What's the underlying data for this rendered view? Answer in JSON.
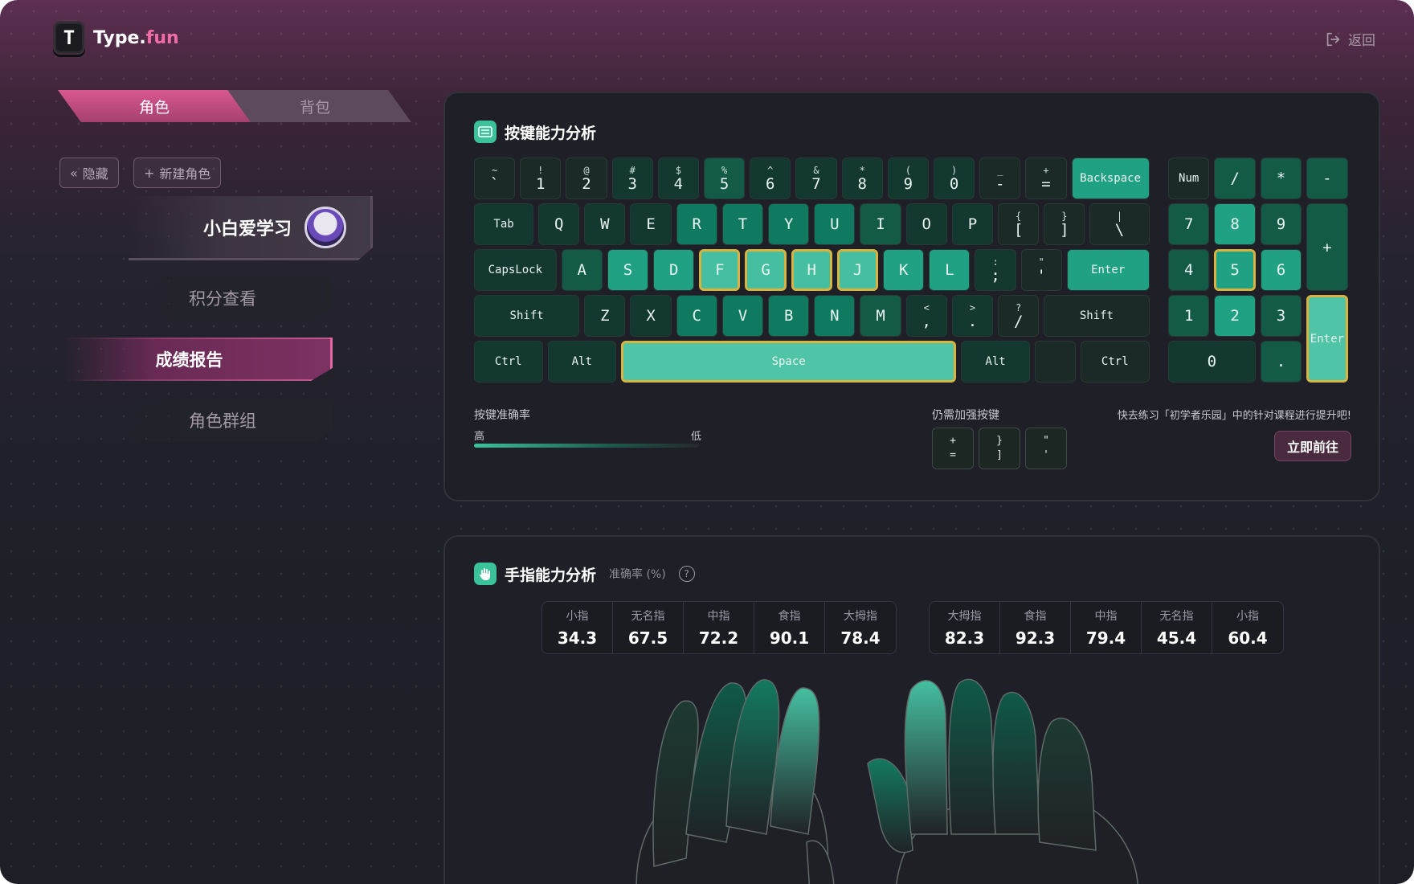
{
  "app": {
    "logo_letter": "T",
    "logo_name": "Type.",
    "logo_suffix": "fun",
    "back_label": "返回"
  },
  "tabs": [
    {
      "label": "角色",
      "active": true
    },
    {
      "label": "背包",
      "active": false
    }
  ],
  "actions": {
    "hide_label": "隐藏",
    "new_role_label": "新建角色"
  },
  "character": {
    "name": "小白爱学习"
  },
  "menu": [
    {
      "label": "积分查看",
      "active": false
    },
    {
      "label": "成绩报告",
      "active": true
    },
    {
      "label": "角色群组",
      "active": false
    }
  ],
  "keys_panel": {
    "title": "按键能力分析",
    "accuracy_label": "按键准确率",
    "high_label": "高",
    "low_label": "低",
    "weak_label": "仍需加强按键",
    "weak_keys": [
      {
        "top": "+",
        "bottom": "="
      },
      {
        "top": "}",
        "bottom": "]"
      },
      {
        "top": "\"",
        "bottom": "'"
      }
    ],
    "tip": "快去练习「初学者乐园」中的针对课程进行提升吧!",
    "go_label": "立即前往"
  },
  "fingers_panel": {
    "title": "手指能力分析",
    "subtitle": "准确率 (%)",
    "help": "?",
    "left": [
      {
        "label": "小指",
        "value": "34.3"
      },
      {
        "label": "无名指",
        "value": "67.5"
      },
      {
        "label": "中指",
        "value": "72.2"
      },
      {
        "label": "食指",
        "value": "90.1"
      },
      {
        "label": "大拇指",
        "value": "78.4"
      }
    ],
    "right": [
      {
        "label": "大拇指",
        "value": "82.3"
      },
      {
        "label": "食指",
        "value": "92.3"
      },
      {
        "label": "中指",
        "value": "79.4"
      },
      {
        "label": "无名指",
        "value": "45.4"
      },
      {
        "label": "小指",
        "value": "60.4"
      }
    ]
  },
  "colors": {
    "accent_pink": "#d8578f",
    "accent_green": "#3cc29b",
    "highlight": "#d9b340"
  },
  "keyboard": {
    "main": [
      [
        {
          "s": "~",
          "m": "`",
          "lvl": 0
        },
        {
          "s": "!",
          "m": "1",
          "lvl": 0
        },
        {
          "s": "@",
          "m": "2",
          "lvl": 0
        },
        {
          "s": "#",
          "m": "3",
          "lvl": 1
        },
        {
          "s": "$",
          "m": "4",
          "lvl": 1
        },
        {
          "s": "%",
          "m": "5",
          "lvl": 2
        },
        {
          "s": "^",
          "m": "6",
          "lvl": 1
        },
        {
          "s": "&",
          "m": "7",
          "lvl": 1
        },
        {
          "s": "*",
          "m": "8",
          "lvl": 1
        },
        {
          "s": "(",
          "m": "9",
          "lvl": 1
        },
        {
          "s": ")",
          "m": "0",
          "lvl": 1
        },
        {
          "s": "_",
          "m": "-",
          "lvl": 0
        },
        {
          "s": "+",
          "m": "=",
          "lvl": 0
        },
        {
          "m": "Backspace",
          "word": true,
          "lvl": 4,
          "w": 1.8
        }
      ],
      [
        {
          "m": "Tab",
          "word": true,
          "lvl": 1,
          "w": 1.4
        },
        {
          "m": "Q",
          "lvl": 1
        },
        {
          "m": "W",
          "lvl": 1
        },
        {
          "m": "E",
          "lvl": 1
        },
        {
          "m": "R",
          "lvl": 3
        },
        {
          "m": "T",
          "lvl": 3
        },
        {
          "m": "Y",
          "lvl": 3
        },
        {
          "m": "U",
          "lvl": 3
        },
        {
          "m": "I",
          "lvl": 2
        },
        {
          "m": "O",
          "lvl": 1
        },
        {
          "m": "P",
          "lvl": 1
        },
        {
          "s": "{",
          "m": "[",
          "lvl": 0
        },
        {
          "s": "}",
          "m": "]",
          "lvl": 0
        },
        {
          "s": "|",
          "m": "\\",
          "lvl": 0,
          "w": 1.4
        }
      ],
      [
        {
          "m": "CapsLock",
          "word": true,
          "lvl": 1,
          "w": 1.9
        },
        {
          "m": "A",
          "lvl": 2
        },
        {
          "m": "S",
          "lvl": 4
        },
        {
          "m": "D",
          "lvl": 4
        },
        {
          "m": "F",
          "lvl": 5,
          "hl": true
        },
        {
          "m": "G",
          "lvl": 5,
          "hl": true
        },
        {
          "m": "H",
          "lvl": 5,
          "hl": true
        },
        {
          "m": "J",
          "lvl": 5,
          "hl": true
        },
        {
          "m": "K",
          "lvl": 4
        },
        {
          "m": "L",
          "lvl": 4
        },
        {
          "s": ":",
          "m": ";",
          "lvl": 1
        },
        {
          "s": "\"",
          "m": "'",
          "lvl": 0
        },
        {
          "m": "Enter",
          "word": true,
          "lvl": 4,
          "w": 1.9
        }
      ],
      [
        {
          "m": "Shift",
          "word": true,
          "lvl": 1,
          "w": 2.4
        },
        {
          "m": "Z",
          "lvl": 1
        },
        {
          "m": "X",
          "lvl": 1
        },
        {
          "m": "C",
          "lvl": 3
        },
        {
          "m": "V",
          "lvl": 3
        },
        {
          "m": "B",
          "lvl": 3
        },
        {
          "m": "N",
          "lvl": 3
        },
        {
          "m": "M",
          "lvl": 2
        },
        {
          "s": "<",
          "m": ",",
          "lvl": 1
        },
        {
          "s": ">",
          "m": ".",
          "lvl": 1
        },
        {
          "s": "?",
          "m": "/",
          "lvl": 0
        },
        {
          "m": "Shift",
          "word": true,
          "lvl": 0,
          "w": 2.4
        }
      ],
      [
        {
          "m": "Ctrl",
          "word": true,
          "lvl": 1,
          "w": 1.6
        },
        {
          "m": "Alt",
          "word": true,
          "lvl": 1,
          "w": 1.6
        },
        {
          "m": "Space",
          "word": true,
          "lvl": 6,
          "hl": true,
          "w": 7.4
        },
        {
          "m": "Alt",
          "word": true,
          "lvl": 1,
          "w": 1.6
        },
        {
          "m": "",
          "lvl": 0,
          "w": 1
        },
        {
          "m": "Ctrl",
          "word": true,
          "lvl": 0,
          "w": 1.6
        }
      ]
    ],
    "numpad": [
      {
        "m": "Num",
        "word": true,
        "lvl": 0,
        "c": 0,
        "r": 0
      },
      {
        "m": "/",
        "lvl": 2,
        "c": 1,
        "r": 0
      },
      {
        "m": "*",
        "lvl": 2,
        "c": 2,
        "r": 0
      },
      {
        "m": "-",
        "lvl": 2,
        "c": 3,
        "r": 0
      },
      {
        "m": "7",
        "lvl": 2,
        "c": 0,
        "r": 1
      },
      {
        "m": "8",
        "lvl": 4,
        "c": 1,
        "r": 1
      },
      {
        "m": "9",
        "lvl": 2,
        "c": 2,
        "r": 1
      },
      {
        "m": "+",
        "lvl": 2,
        "c": 3,
        "r": 1,
        "h": 2
      },
      {
        "m": "4",
        "lvl": 2,
        "c": 0,
        "r": 2
      },
      {
        "m": "5",
        "lvl": 4,
        "hl": true,
        "c": 1,
        "r": 2
      },
      {
        "m": "6",
        "lvl": 4,
        "c": 2,
        "r": 2
      },
      {
        "m": "1",
        "lvl": 2,
        "c": 0,
        "r": 3
      },
      {
        "m": "2",
        "lvl": 4,
        "c": 1,
        "r": 3
      },
      {
        "m": "3",
        "lvl": 2,
        "c": 2,
        "r": 3
      },
      {
        "m": "Enter",
        "word": true,
        "lvl": 6,
        "hl": true,
        "c": 3,
        "r": 3,
        "h": 2
      },
      {
        "m": "0",
        "lvl": 1,
        "c": 0,
        "r": 4,
        "w": 2
      },
      {
        "m": ".",
        "lvl": 2,
        "c": 2,
        "r": 4
      }
    ]
  }
}
